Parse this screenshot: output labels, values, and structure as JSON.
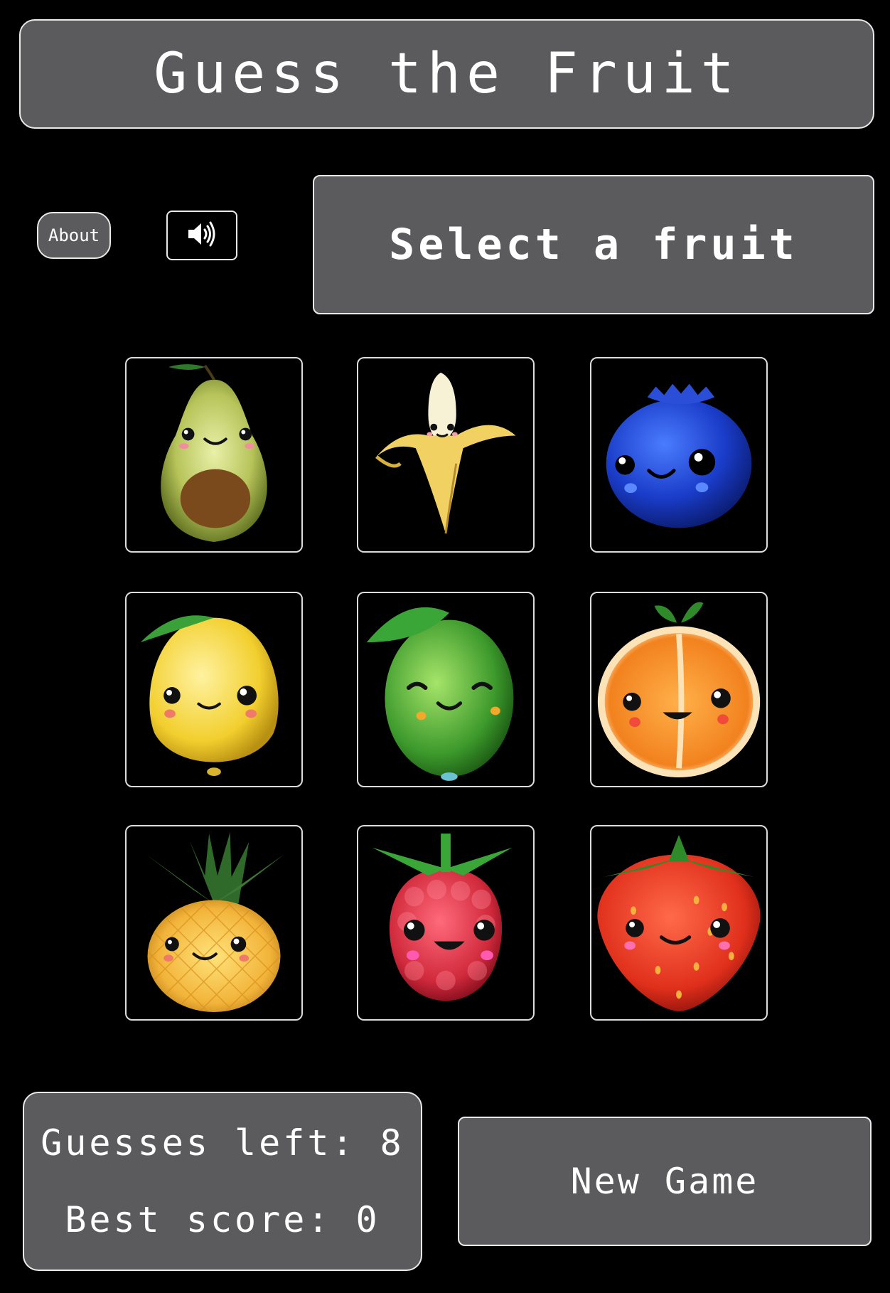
{
  "header": {
    "title": "Guess the Fruit"
  },
  "controls": {
    "about_label": "About",
    "sound_icon": "speaker-volume-icon"
  },
  "prompt": {
    "text": "Select a fruit"
  },
  "fruits": [
    {
      "name": "avocado",
      "icon": "avocado-icon"
    },
    {
      "name": "banana",
      "icon": "banana-icon"
    },
    {
      "name": "blueberry",
      "icon": "blueberry-icon"
    },
    {
      "name": "lemon",
      "icon": "lemon-icon"
    },
    {
      "name": "lime",
      "icon": "lime-icon"
    },
    {
      "name": "orange",
      "icon": "orange-icon"
    },
    {
      "name": "pineapple",
      "icon": "pineapple-icon"
    },
    {
      "name": "raspberry",
      "icon": "raspberry-icon"
    },
    {
      "name": "strawberry",
      "icon": "strawberry-icon"
    }
  ],
  "stats": {
    "guesses_left": "Guesses left: 8",
    "best_score": "Best score: 0"
  },
  "actions": {
    "new_game_label": "New Game"
  }
}
